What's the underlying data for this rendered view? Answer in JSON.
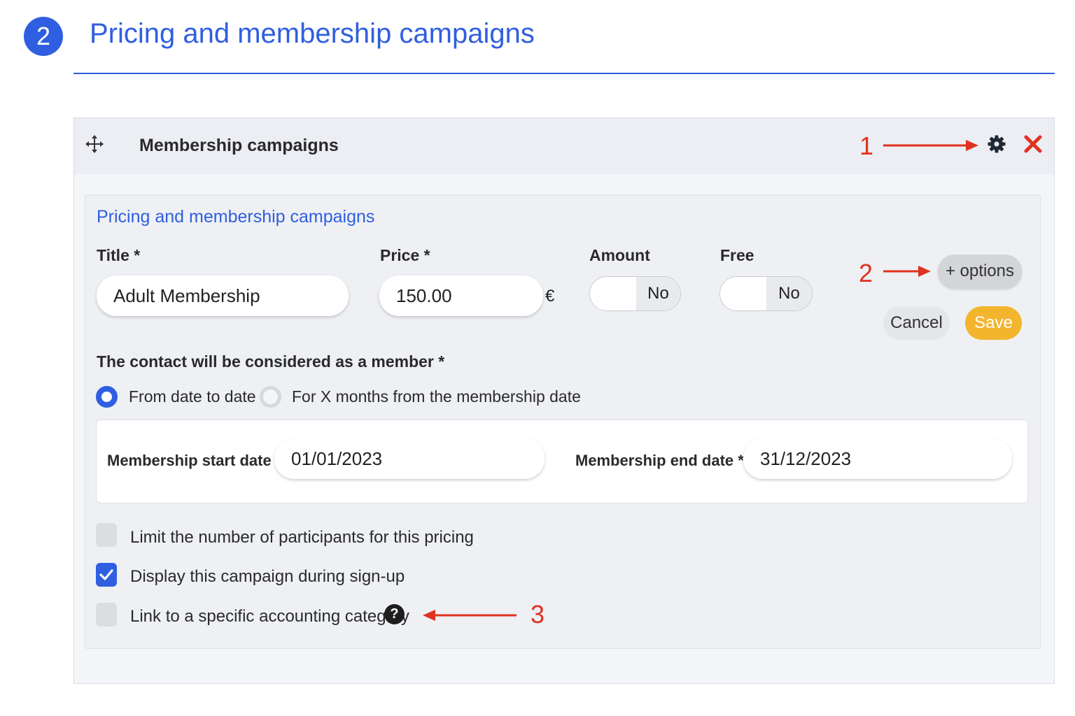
{
  "step": {
    "number": "2",
    "title": "Pricing and membership campaigns"
  },
  "panel": {
    "title": "Membership campaigns",
    "icons": [
      "move-icon",
      "gear-icon",
      "close-icon"
    ]
  },
  "annotations": {
    "one": "1",
    "two": "2",
    "three": "3",
    "color": "#e0321e"
  },
  "form": {
    "section_title": "Pricing and membership campaigns",
    "title_label": "Title *",
    "title_value": "Adult Membership",
    "price_label": "Price *",
    "price_value": "150.00",
    "currency": "€",
    "amount_label": "Amount",
    "amount_value": "No",
    "free_label": "Free",
    "free_value": "No",
    "options_button": "+ options",
    "cancel_button": "Cancel",
    "save_button": "Save"
  },
  "membership": {
    "question": "The contact will be considered as a member *",
    "option_1": "From date to date",
    "option_2": "For X months from the membership date",
    "selected": "From date to date",
    "start_label": "Membership start date *",
    "start_value": "01/01/2023",
    "end_label": "Membership end date *",
    "end_value": "31/12/2023"
  },
  "checkboxes": [
    {
      "label": "Limit the number of participants for this pricing",
      "checked": false
    },
    {
      "label": "Display this campaign during sign-up",
      "checked": true
    },
    {
      "label": "Link to a specific accounting category",
      "checked": false
    }
  ],
  "colors": {
    "accent": "#2f5fe0",
    "save": "#f3b52e",
    "close": "#e0321e"
  }
}
